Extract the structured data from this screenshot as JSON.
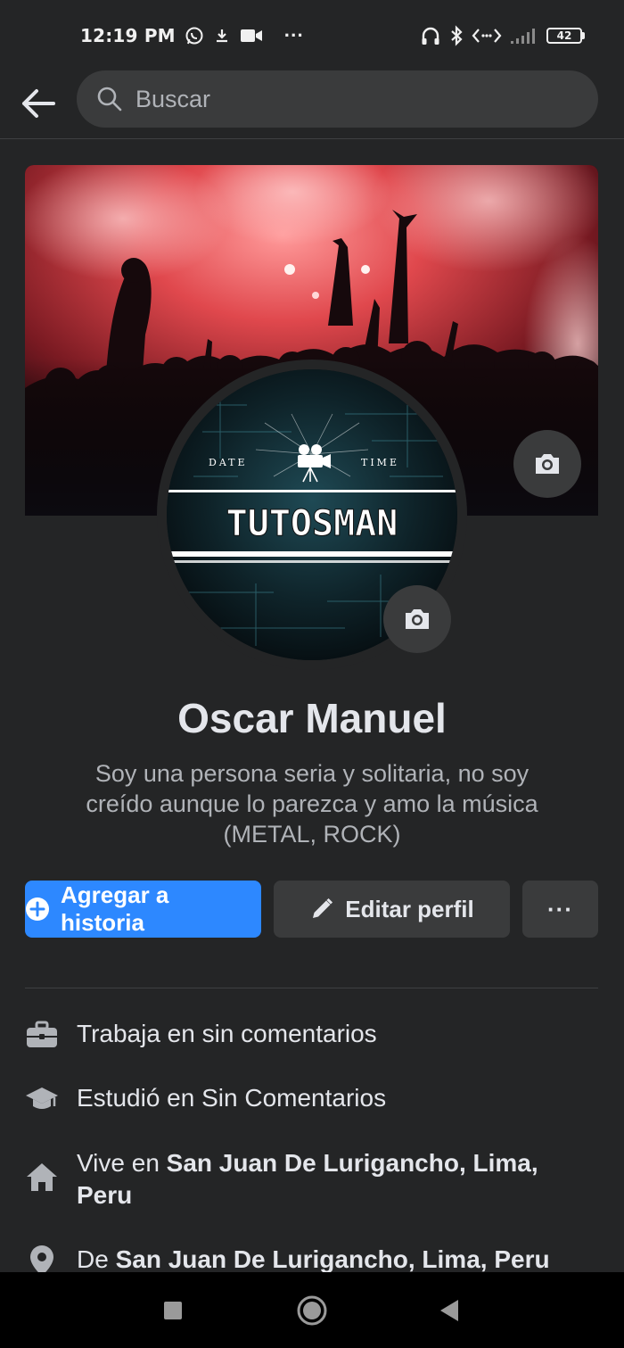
{
  "status_bar": {
    "time": "12:19 PM",
    "more": "···",
    "battery": "42"
  },
  "search": {
    "placeholder": "Buscar"
  },
  "avatar_logo": {
    "date": "DATE",
    "time": "TIME",
    "brand": "TUTOSMAN"
  },
  "profile": {
    "name": "Oscar Manuel",
    "bio": "Soy una persona seria y solitaria, no soy creído aunque lo parezca y amo la música (METAL, ROCK)"
  },
  "actions": {
    "add_story": "Agregar a historia",
    "edit_profile": "Editar perfil",
    "more": "···"
  },
  "details": {
    "work": "Trabaja en sin comentarios",
    "study": "Estudió en Sin Comentarios",
    "lives_prefix": "Vive en ",
    "lives_place_1": "San Juan De Lurigancho, Lima,",
    "lives_place_2": "Peru",
    "from_prefix": "De ",
    "from_place": "San Juan De Lurigancho, Lima, Peru"
  },
  "colors": {
    "background": "#242526",
    "primary_button": "#2d88ff",
    "secondary_button": "#3a3b3c",
    "text": "#e4e6eb",
    "muted_text": "#b0b3b8"
  }
}
